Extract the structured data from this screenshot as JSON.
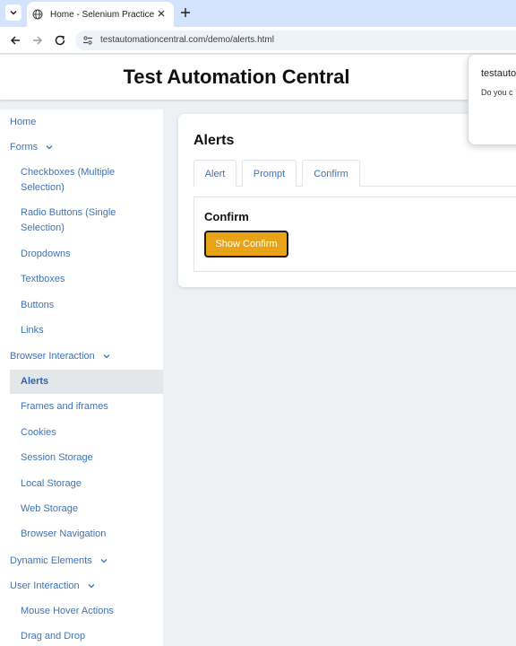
{
  "browser": {
    "tab_title": "Home - Selenium Practice",
    "url": "testautomationcentral.com/demo/alerts.html"
  },
  "header": {
    "title": "Test Automation Central"
  },
  "sidebar": {
    "home": "Home",
    "forms": "Forms",
    "checkboxes": "Checkboxes (Multiple Selection)",
    "radio_buttons": "Radio Buttons (Single Selection)",
    "dropdowns": "Dropdowns",
    "textboxes": "Textboxes",
    "buttons": "Buttons",
    "links": "Links",
    "browser_interaction": "Browser Interaction",
    "alerts": "Alerts",
    "frames": "Frames and iframes",
    "cookies": "Cookies",
    "session_storage": "Session Storage",
    "local_storage": "Local Storage",
    "web_storage": "Web Storage",
    "browser_navigation": "Browser Navigation",
    "dynamic_elements": "Dynamic Elements",
    "user_interaction": "User Interaction",
    "mouse_hover": "Mouse Hover Actions",
    "drag_drop": "Drag and Drop"
  },
  "main": {
    "title": "Alerts",
    "tabs": {
      "alert": "Alert",
      "prompt": "Prompt",
      "confirm": "Confirm"
    },
    "panel_title": "Confirm",
    "button_label": "Show Confirm"
  },
  "dialog": {
    "host": "testauto",
    "message": "Do you c"
  },
  "colors": {
    "accent": "#e8a317",
    "link": "#3f73b5",
    "tabbar": "#d3e3fd"
  }
}
